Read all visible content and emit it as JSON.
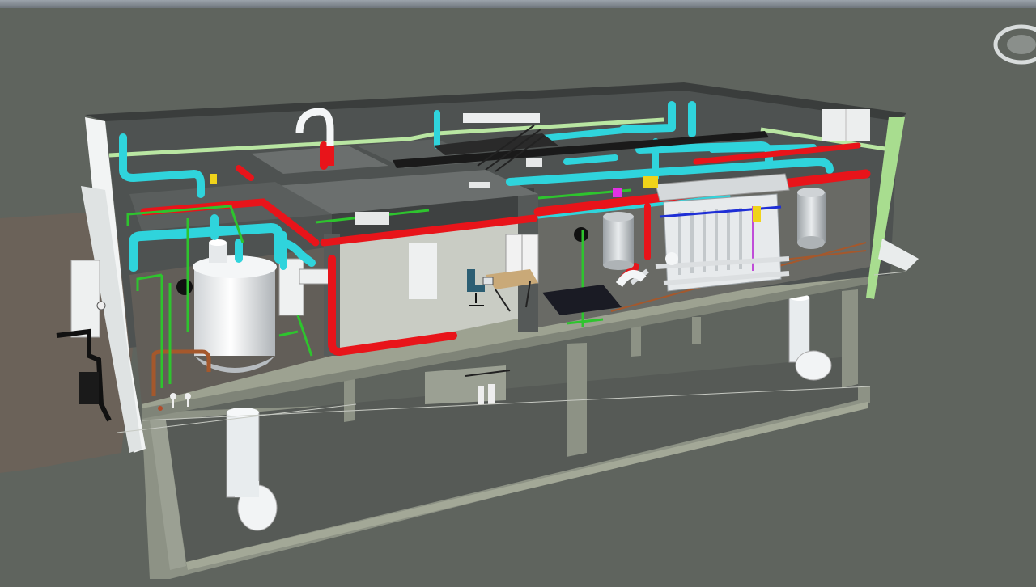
{
  "viewer": {
    "mode": "3d-model-viewport",
    "view_cube_icon": "view-cube-icon",
    "colors": {
      "background": "#5f645e",
      "ground": "#6b6259",
      "concrete": "#8d9285",
      "wall_dark": "#4a4d4c",
      "floor": "#c9ccc4",
      "supply_air": "#2fd4dc",
      "hot_water": "#e8141a",
      "cold_water": "#2ec42e",
      "trim_green": "#b9e6a2",
      "equipment": "#e8ecee",
      "copper": "#a5582c"
    }
  }
}
